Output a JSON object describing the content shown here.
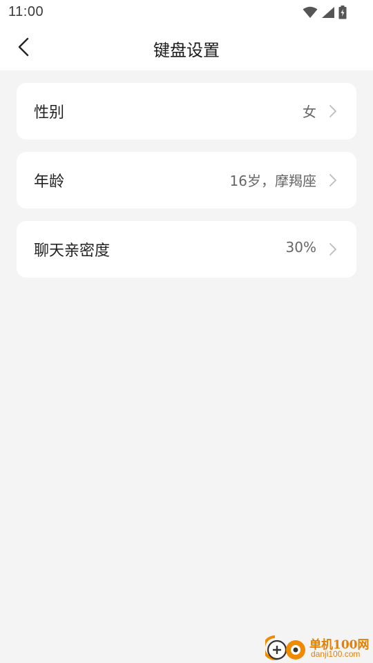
{
  "status_bar": {
    "time": "11:00",
    "icons": [
      "wifi-icon",
      "cell-signal-icon",
      "battery-charging-icon"
    ]
  },
  "header": {
    "title": "键盘设置",
    "back_icon": "chevron-left-icon"
  },
  "settings": [
    {
      "label": "性别",
      "value": "女"
    },
    {
      "label": "年龄",
      "value": "16岁，摩羯座"
    },
    {
      "label": "聊天亲密度",
      "value": "30%"
    }
  ],
  "watermark": {
    "name": "单机100网",
    "url": "danji100.com"
  },
  "colors": {
    "background": "#f4f4f4",
    "card": "#ffffff",
    "watermark_accent": "#e67e00"
  }
}
